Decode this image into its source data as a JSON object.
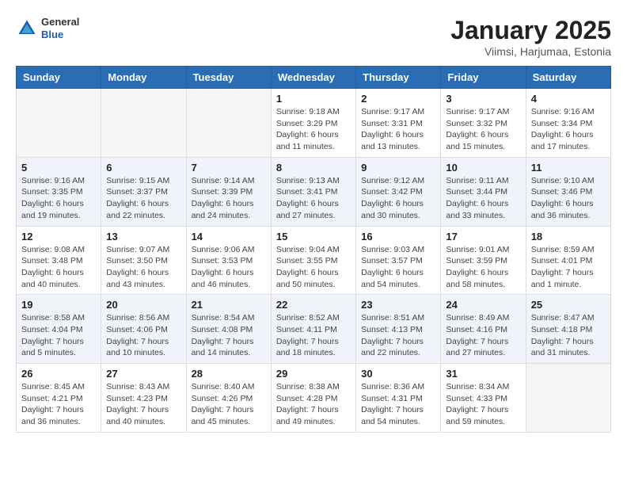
{
  "header": {
    "logo_general": "General",
    "logo_blue": "Blue",
    "title": "January 2025",
    "subtitle": "Viimsi, Harjumaa, Estonia"
  },
  "weekdays": [
    "Sunday",
    "Monday",
    "Tuesday",
    "Wednesday",
    "Thursday",
    "Friday",
    "Saturday"
  ],
  "weeks": [
    {
      "days": [
        {
          "num": "",
          "info": "",
          "empty": true
        },
        {
          "num": "",
          "info": "",
          "empty": true
        },
        {
          "num": "",
          "info": "",
          "empty": true
        },
        {
          "num": "1",
          "info": "Sunrise: 9:18 AM\nSunset: 3:29 PM\nDaylight: 6 hours\nand 11 minutes.",
          "empty": false
        },
        {
          "num": "2",
          "info": "Sunrise: 9:17 AM\nSunset: 3:31 PM\nDaylight: 6 hours\nand 13 minutes.",
          "empty": false
        },
        {
          "num": "3",
          "info": "Sunrise: 9:17 AM\nSunset: 3:32 PM\nDaylight: 6 hours\nand 15 minutes.",
          "empty": false
        },
        {
          "num": "4",
          "info": "Sunrise: 9:16 AM\nSunset: 3:34 PM\nDaylight: 6 hours\nand 17 minutes.",
          "empty": false
        }
      ],
      "alt": false
    },
    {
      "days": [
        {
          "num": "5",
          "info": "Sunrise: 9:16 AM\nSunset: 3:35 PM\nDaylight: 6 hours\nand 19 minutes.",
          "empty": false
        },
        {
          "num": "6",
          "info": "Sunrise: 9:15 AM\nSunset: 3:37 PM\nDaylight: 6 hours\nand 22 minutes.",
          "empty": false
        },
        {
          "num": "7",
          "info": "Sunrise: 9:14 AM\nSunset: 3:39 PM\nDaylight: 6 hours\nand 24 minutes.",
          "empty": false
        },
        {
          "num": "8",
          "info": "Sunrise: 9:13 AM\nSunset: 3:41 PM\nDaylight: 6 hours\nand 27 minutes.",
          "empty": false
        },
        {
          "num": "9",
          "info": "Sunrise: 9:12 AM\nSunset: 3:42 PM\nDaylight: 6 hours\nand 30 minutes.",
          "empty": false
        },
        {
          "num": "10",
          "info": "Sunrise: 9:11 AM\nSunset: 3:44 PM\nDaylight: 6 hours\nand 33 minutes.",
          "empty": false
        },
        {
          "num": "11",
          "info": "Sunrise: 9:10 AM\nSunset: 3:46 PM\nDaylight: 6 hours\nand 36 minutes.",
          "empty": false
        }
      ],
      "alt": true
    },
    {
      "days": [
        {
          "num": "12",
          "info": "Sunrise: 9:08 AM\nSunset: 3:48 PM\nDaylight: 6 hours\nand 40 minutes.",
          "empty": false
        },
        {
          "num": "13",
          "info": "Sunrise: 9:07 AM\nSunset: 3:50 PM\nDaylight: 6 hours\nand 43 minutes.",
          "empty": false
        },
        {
          "num": "14",
          "info": "Sunrise: 9:06 AM\nSunset: 3:53 PM\nDaylight: 6 hours\nand 46 minutes.",
          "empty": false
        },
        {
          "num": "15",
          "info": "Sunrise: 9:04 AM\nSunset: 3:55 PM\nDaylight: 6 hours\nand 50 minutes.",
          "empty": false
        },
        {
          "num": "16",
          "info": "Sunrise: 9:03 AM\nSunset: 3:57 PM\nDaylight: 6 hours\nand 54 minutes.",
          "empty": false
        },
        {
          "num": "17",
          "info": "Sunrise: 9:01 AM\nSunset: 3:59 PM\nDaylight: 6 hours\nand 58 minutes.",
          "empty": false
        },
        {
          "num": "18",
          "info": "Sunrise: 8:59 AM\nSunset: 4:01 PM\nDaylight: 7 hours\nand 1 minute.",
          "empty": false
        }
      ],
      "alt": false
    },
    {
      "days": [
        {
          "num": "19",
          "info": "Sunrise: 8:58 AM\nSunset: 4:04 PM\nDaylight: 7 hours\nand 5 minutes.",
          "empty": false
        },
        {
          "num": "20",
          "info": "Sunrise: 8:56 AM\nSunset: 4:06 PM\nDaylight: 7 hours\nand 10 minutes.",
          "empty": false
        },
        {
          "num": "21",
          "info": "Sunrise: 8:54 AM\nSunset: 4:08 PM\nDaylight: 7 hours\nand 14 minutes.",
          "empty": false
        },
        {
          "num": "22",
          "info": "Sunrise: 8:52 AM\nSunset: 4:11 PM\nDaylight: 7 hours\nand 18 minutes.",
          "empty": false
        },
        {
          "num": "23",
          "info": "Sunrise: 8:51 AM\nSunset: 4:13 PM\nDaylight: 7 hours\nand 22 minutes.",
          "empty": false
        },
        {
          "num": "24",
          "info": "Sunrise: 8:49 AM\nSunset: 4:16 PM\nDaylight: 7 hours\nand 27 minutes.",
          "empty": false
        },
        {
          "num": "25",
          "info": "Sunrise: 8:47 AM\nSunset: 4:18 PM\nDaylight: 7 hours\nand 31 minutes.",
          "empty": false
        }
      ],
      "alt": true
    },
    {
      "days": [
        {
          "num": "26",
          "info": "Sunrise: 8:45 AM\nSunset: 4:21 PM\nDaylight: 7 hours\nand 36 minutes.",
          "empty": false
        },
        {
          "num": "27",
          "info": "Sunrise: 8:43 AM\nSunset: 4:23 PM\nDaylight: 7 hours\nand 40 minutes.",
          "empty": false
        },
        {
          "num": "28",
          "info": "Sunrise: 8:40 AM\nSunset: 4:26 PM\nDaylight: 7 hours\nand 45 minutes.",
          "empty": false
        },
        {
          "num": "29",
          "info": "Sunrise: 8:38 AM\nSunset: 4:28 PM\nDaylight: 7 hours\nand 49 minutes.",
          "empty": false
        },
        {
          "num": "30",
          "info": "Sunrise: 8:36 AM\nSunset: 4:31 PM\nDaylight: 7 hours\nand 54 minutes.",
          "empty": false
        },
        {
          "num": "31",
          "info": "Sunrise: 8:34 AM\nSunset: 4:33 PM\nDaylight: 7 hours\nand 59 minutes.",
          "empty": false
        },
        {
          "num": "",
          "info": "",
          "empty": true
        }
      ],
      "alt": false
    }
  ]
}
